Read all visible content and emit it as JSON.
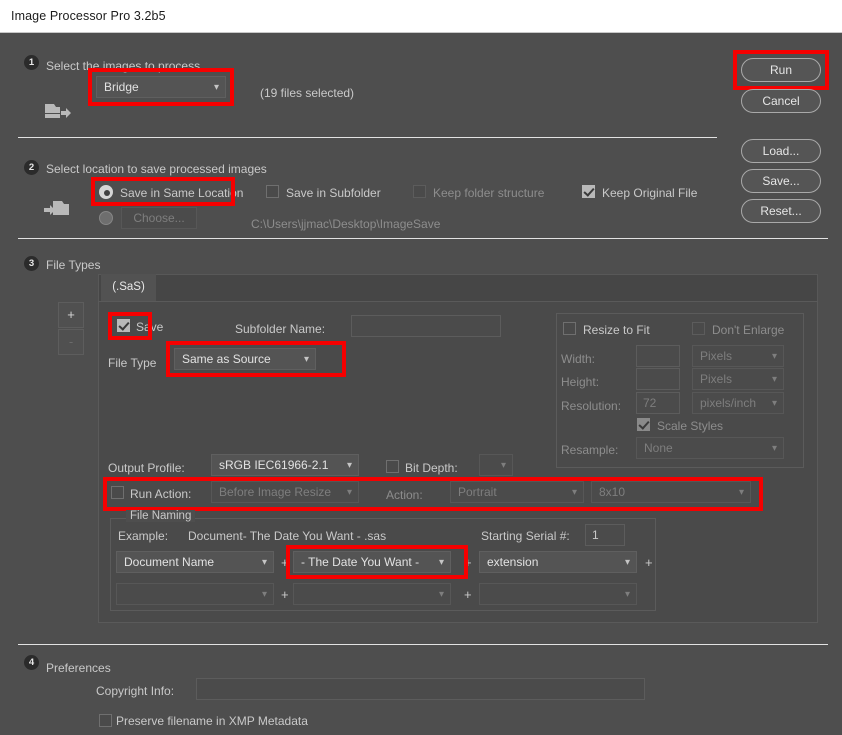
{
  "window": {
    "title": "Image Processor Pro 3.2b5"
  },
  "colors": {
    "accent_highlight": "#f60000",
    "background": "#4e4e4e",
    "titlebar": "#ffffff"
  },
  "step1": {
    "number": "1",
    "heading": "Select the images to process",
    "source_select": {
      "value": "Bridge",
      "icon": "chevron-down-icon"
    },
    "files_selected": "(19 files selected)",
    "icon": "folder-open-arrow-icon"
  },
  "step2": {
    "number": "2",
    "heading": "Select location to save processed images",
    "icon": "folder-save-arrow-icon",
    "save_same_location": {
      "label": "Save in Same Location",
      "checked": true
    },
    "save_in_subfolder": {
      "label": "Save in Subfolder",
      "checked": false
    },
    "keep_folder_structure": {
      "label": "Keep folder structure",
      "checked": false,
      "disabled": true
    },
    "keep_original_file": {
      "label": "Keep Original File",
      "checked": true
    },
    "choose_radio": {
      "checked": false
    },
    "choose_button": "Choose...",
    "path": "C:\\Users\\jjmac\\Desktop\\ImageSave"
  },
  "step3": {
    "number": "3",
    "heading": "File Types",
    "add_button": "+",
    "remove_button": "-",
    "tab": "(.SaS)",
    "save_checkbox": {
      "label": "Save",
      "checked": true
    },
    "subfolder_name_label": "Subfolder Name:",
    "subfolder_name_value": "",
    "file_type_label": "File Type",
    "file_type_value": "Same as Source",
    "resize": {
      "resize_to_fit": {
        "label": "Resize to Fit",
        "checked": false
      },
      "dont_enlarge": {
        "label": "Don't Enlarge",
        "checked": false,
        "disabled": true
      },
      "width_label": "Width:",
      "width_value": "",
      "width_unit": "Pixels",
      "height_label": "Height:",
      "height_value": "",
      "height_unit": "Pixels",
      "resolution_label": "Resolution:",
      "resolution_value": "72",
      "resolution_unit": "pixels/inch",
      "scale_styles": {
        "label": "Scale Styles",
        "checked": true,
        "disabled": true
      },
      "resample_label": "Resample:",
      "resample_value": "None"
    },
    "output_profile_label": "Output Profile:",
    "output_profile_value": "sRGB IEC61966-2.1",
    "bit_depth": {
      "label": "Bit Depth:",
      "checked": false,
      "value": ""
    },
    "run_action": {
      "label": "Run Action:",
      "checked": false,
      "value": "Before Image Resize"
    },
    "action_label": "Action:",
    "action_set_value": "Portrait",
    "action_value": "8x10",
    "file_naming": {
      "title": "File Naming",
      "example_label": "Example:",
      "example_value": "Document- The Date You Want - .sas",
      "starting_serial_label": "Starting Serial #:",
      "starting_serial_value": "1",
      "row1": [
        "Document Name",
        "- The Date You Want -",
        "extension"
      ],
      "row2": [
        "",
        "",
        ""
      ],
      "separator": "+"
    }
  },
  "step4": {
    "number": "4",
    "heading": "Preferences",
    "copyright_label": "Copyright Info:",
    "copyright_value": "",
    "preserve_filename": {
      "label": "Preserve filename in XMP Metadata",
      "checked": false
    }
  },
  "actions": {
    "run": "Run",
    "cancel": "Cancel",
    "load": "Load...",
    "save": "Save...",
    "reset": "Reset..."
  }
}
